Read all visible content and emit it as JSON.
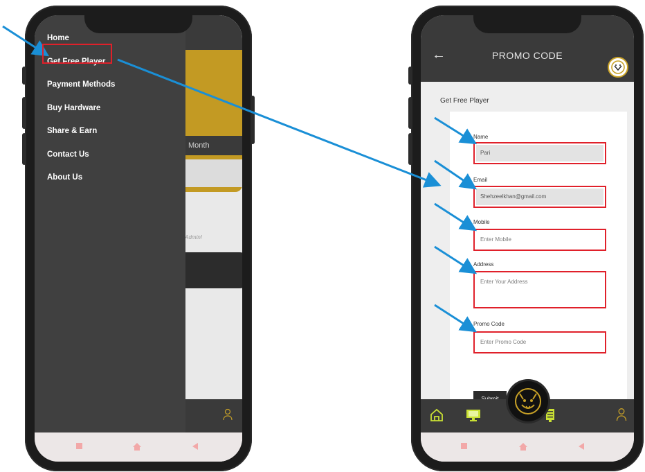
{
  "left_phone": {
    "drawer_menu": [
      "Home",
      "Get Free Player",
      "Payment Methods",
      "Buy Hardware",
      "Share & Earn",
      "Contact Us",
      "About Us"
    ],
    "background": {
      "month_pill_text": "Month",
      "admin_text": "erAdmin!"
    }
  },
  "right_phone": {
    "header": {
      "title": "PROMO CODE",
      "back_icon": "arrow-left-icon",
      "avatar_icon": "bulldog-logo-icon"
    },
    "section_title": "Get Free Player",
    "form": {
      "name_label": "Name",
      "name_value": "Pari",
      "email_label": "Email",
      "email_value": "Shehzeelkhan@gmail.com",
      "mobile_label": "Mobile",
      "mobile_placeholder": "Enter Mobile",
      "address_label": "Address",
      "address_placeholder": "Enter Your Address",
      "promo_label": "Promo Code",
      "promo_placeholder": "Enter Promo Code",
      "submit_label": "Submit"
    },
    "bottom_nav": [
      "home-icon",
      "monitor-icon",
      "bulldog-logo-icon",
      "document-icon",
      "user-icon"
    ]
  },
  "colors": {
    "annotation_arrow": "#1a8fd6",
    "annotation_box": "#e0202a",
    "accent": "#c9a227",
    "dark_bar": "#3a3a3a"
  }
}
